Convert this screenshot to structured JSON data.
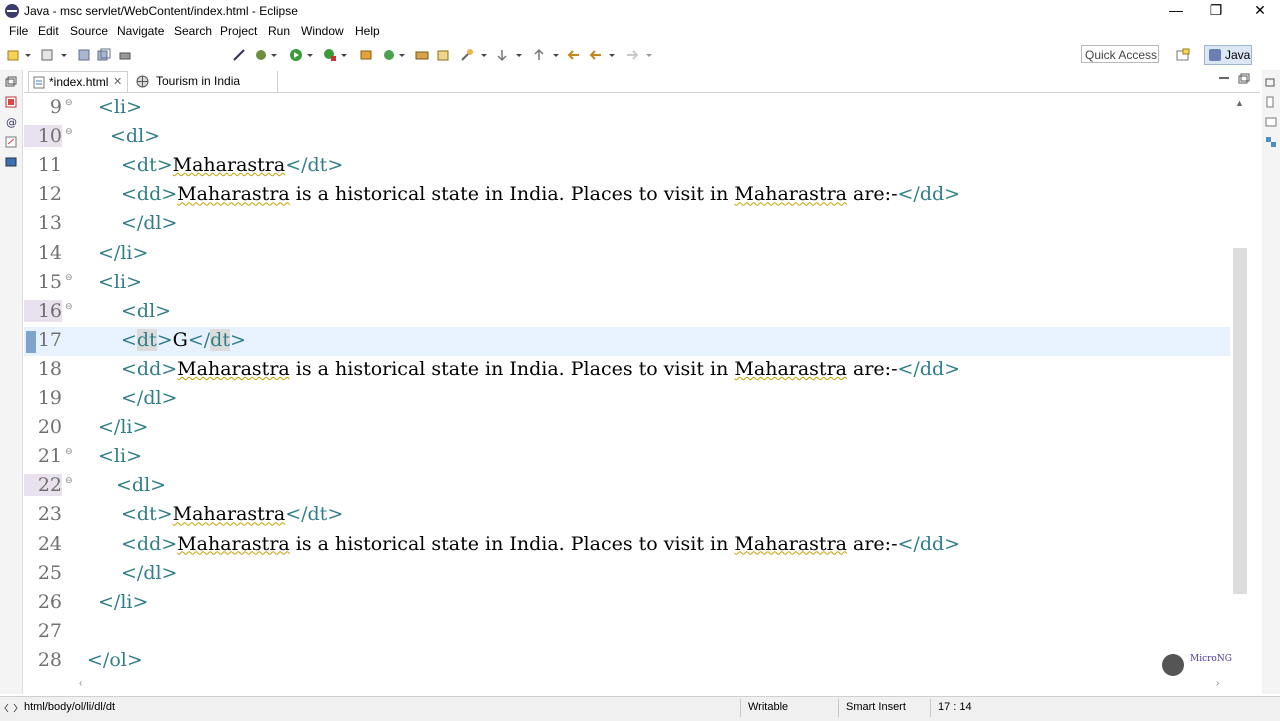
{
  "window": {
    "title": "Java - msc servlet/WebContent/index.html - Eclipse",
    "min_glyph": "—",
    "max_glyph": "❐",
    "close_glyph": "✕"
  },
  "menu": [
    "File",
    "Edit",
    "Source",
    "Navigate",
    "Search",
    "Project",
    "Run",
    "Window",
    "Help"
  ],
  "toolbar": {
    "quick_access": "Quick Access",
    "perspective": "Java"
  },
  "tabs": [
    {
      "label": "*index.html",
      "close": "✕",
      "active": true
    },
    {
      "label": "Tourism in India",
      "active": false
    }
  ],
  "editor": {
    "lines": [
      {
        "num": "9",
        "fold": "⊖",
        "indent": 60,
        "parts": [
          {
            "t": "<li>",
            "c": "tag"
          }
        ]
      },
      {
        "num": "10",
        "fold": "⊖",
        "indent": 72,
        "parts": [
          {
            "t": "<dl>",
            "c": "tag"
          }
        ]
      },
      {
        "num": "11",
        "indent": 83,
        "parts": [
          {
            "t": "<dt>",
            "c": "tag"
          },
          {
            "t": "Maharastra",
            "c": "txt sq"
          },
          {
            "t": "</dt>",
            "c": "tag"
          }
        ]
      },
      {
        "num": "12",
        "indent": 83,
        "parts": [
          {
            "t": "<dd>",
            "c": "tag"
          },
          {
            "t": "Maharastra",
            "c": "txt sq"
          },
          {
            "t": " is a historical state in India. Places to visit in ",
            "c": "txt"
          },
          {
            "t": "Maharastra",
            "c": "txt sq"
          },
          {
            "t": " are:-",
            "c": "txt"
          },
          {
            "t": "</dd>",
            "c": "tag"
          }
        ]
      },
      {
        "num": "13",
        "indent": 83,
        "parts": [
          {
            "t": "</dl>",
            "c": "tag"
          }
        ]
      },
      {
        "num": "14",
        "indent": 60,
        "parts": [
          {
            "t": "</li>",
            "c": "tag"
          }
        ]
      },
      {
        "num": "15",
        "fold": "⊖",
        "indent": 60,
        "parts": [
          {
            "t": "<li>",
            "c": "tag"
          }
        ]
      },
      {
        "num": "16",
        "fold": "⊖",
        "indent": 83,
        "parts": [
          {
            "t": "<dl>",
            "c": "tag"
          }
        ]
      },
      {
        "num": "17",
        "current": true,
        "indent": 83,
        "parts": [
          {
            "t": "<",
            "c": "tag"
          },
          {
            "t": "dt",
            "c": "tag hl"
          },
          {
            "t": ">",
            "c": "tag"
          },
          {
            "t": "G",
            "c": "txt"
          },
          {
            "t": "</",
            "c": "tag"
          },
          {
            "t": "dt",
            "c": "tag hl"
          },
          {
            "t": ">",
            "c": "tag"
          }
        ]
      },
      {
        "num": "18",
        "indent": 83,
        "parts": [
          {
            "t": "<dd>",
            "c": "tag"
          },
          {
            "t": "Maharastra",
            "c": "txt sq"
          },
          {
            "t": " is a historical state in India. Places to visit in ",
            "c": "txt"
          },
          {
            "t": "Maharastra",
            "c": "txt sq"
          },
          {
            "t": " are:-",
            "c": "txt"
          },
          {
            "t": "</dd>",
            "c": "tag"
          }
        ]
      },
      {
        "num": "19",
        "indent": 83,
        "parts": [
          {
            "t": "</dl>",
            "c": "tag"
          }
        ]
      },
      {
        "num": "20",
        "indent": 60,
        "parts": [
          {
            "t": "</li>",
            "c": "tag"
          }
        ]
      },
      {
        "num": "21",
        "fold": "⊖",
        "indent": 60,
        "parts": [
          {
            "t": "<li>",
            "c": "tag"
          }
        ]
      },
      {
        "num": "22",
        "fold": "⊖",
        "indent": 78,
        "parts": [
          {
            "t": "<dl>",
            "c": "tag"
          }
        ]
      },
      {
        "num": "23",
        "indent": 83,
        "parts": [
          {
            "t": "<dt>",
            "c": "tag"
          },
          {
            "t": "Maharastra",
            "c": "txt sq"
          },
          {
            "t": "</dt>",
            "c": "tag"
          }
        ]
      },
      {
        "num": "24",
        "indent": 83,
        "parts": [
          {
            "t": "<dd>",
            "c": "tag"
          },
          {
            "t": "Maharastra",
            "c": "txt sq"
          },
          {
            "t": " is a historical state in India. Places to visit in ",
            "c": "txt"
          },
          {
            "t": "Maharastra",
            "c": "txt sq"
          },
          {
            "t": " are:-",
            "c": "txt"
          },
          {
            "t": "</dd>",
            "c": "tag"
          }
        ]
      },
      {
        "num": "25",
        "indent": 83,
        "parts": [
          {
            "t": "</dl>",
            "c": "tag"
          }
        ]
      },
      {
        "num": "26",
        "indent": 60,
        "parts": [
          {
            "t": "</li>",
            "c": "tag"
          }
        ]
      },
      {
        "num": "27",
        "indent": 60,
        "parts": []
      },
      {
        "num": "28",
        "indent": 49,
        "parts": [
          {
            "t": "</ol>",
            "c": "tag"
          }
        ]
      }
    ]
  },
  "status": {
    "breadcrumb": "html/body/ol/li/dl/dt",
    "writable": "Writable",
    "insert_mode": "Smart Insert",
    "position": "17 : 14"
  },
  "watermark": {
    "text": "MicroNG"
  },
  "colors": {
    "tag": "#2f7e87",
    "current_line": "#e8f2fe",
    "accent": "#dbe7f5"
  }
}
